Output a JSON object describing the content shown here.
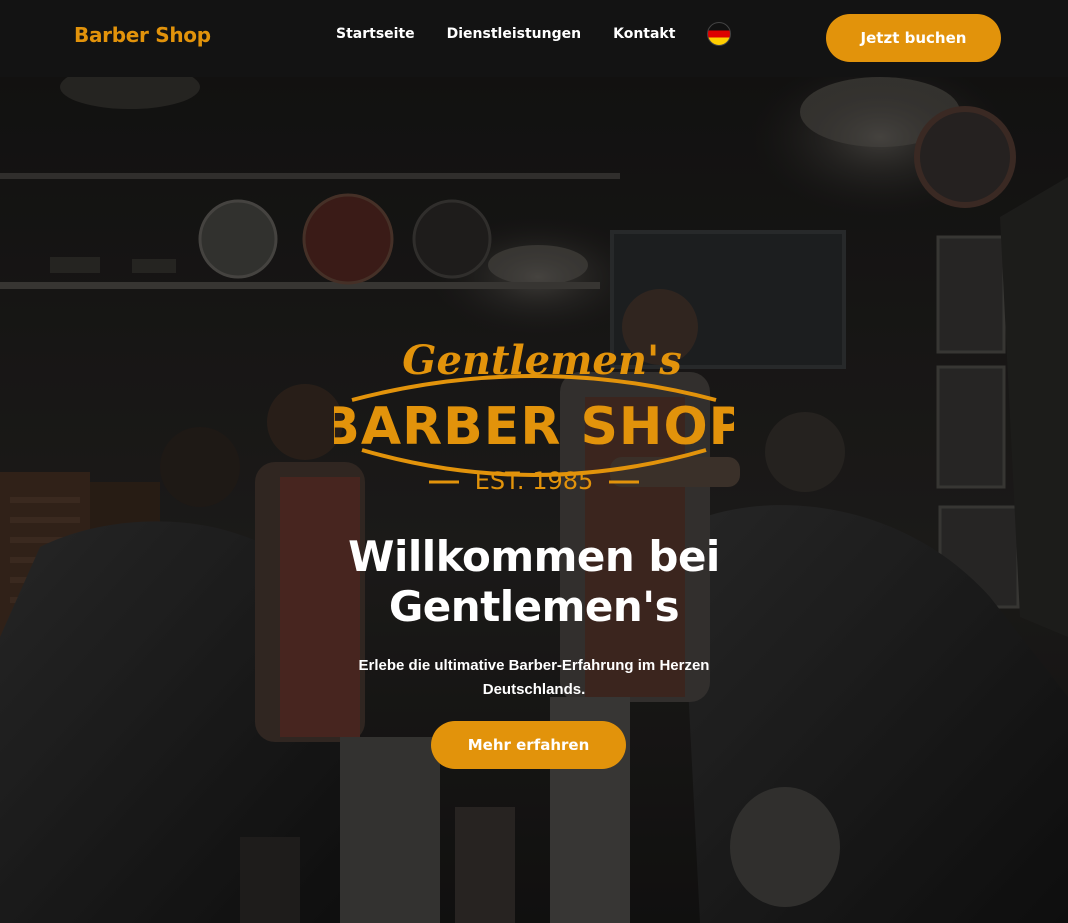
{
  "header": {
    "brand": "Barber Shop",
    "nav": [
      {
        "label": "Startseite"
      },
      {
        "label": "Dienstleistungen"
      },
      {
        "label": "Kontakt"
      }
    ],
    "language_icon": "germany-flag-icon",
    "cta_label": "Jetzt buchen"
  },
  "hero": {
    "logo": {
      "script_text": "Gentlemen's",
      "main_text": "BARBER SHOP",
      "est_text": "EST. 1985"
    },
    "title": "Willkommen bei Gentlemen's",
    "subtitle": "Erlebe die ultimative Barber-Erfahrung im Herzen Deutschlands.",
    "cta_label": "Mehr erfahren"
  },
  "colors": {
    "accent": "#e2930b",
    "header_bg": "#131313",
    "text": "#ffffff"
  }
}
